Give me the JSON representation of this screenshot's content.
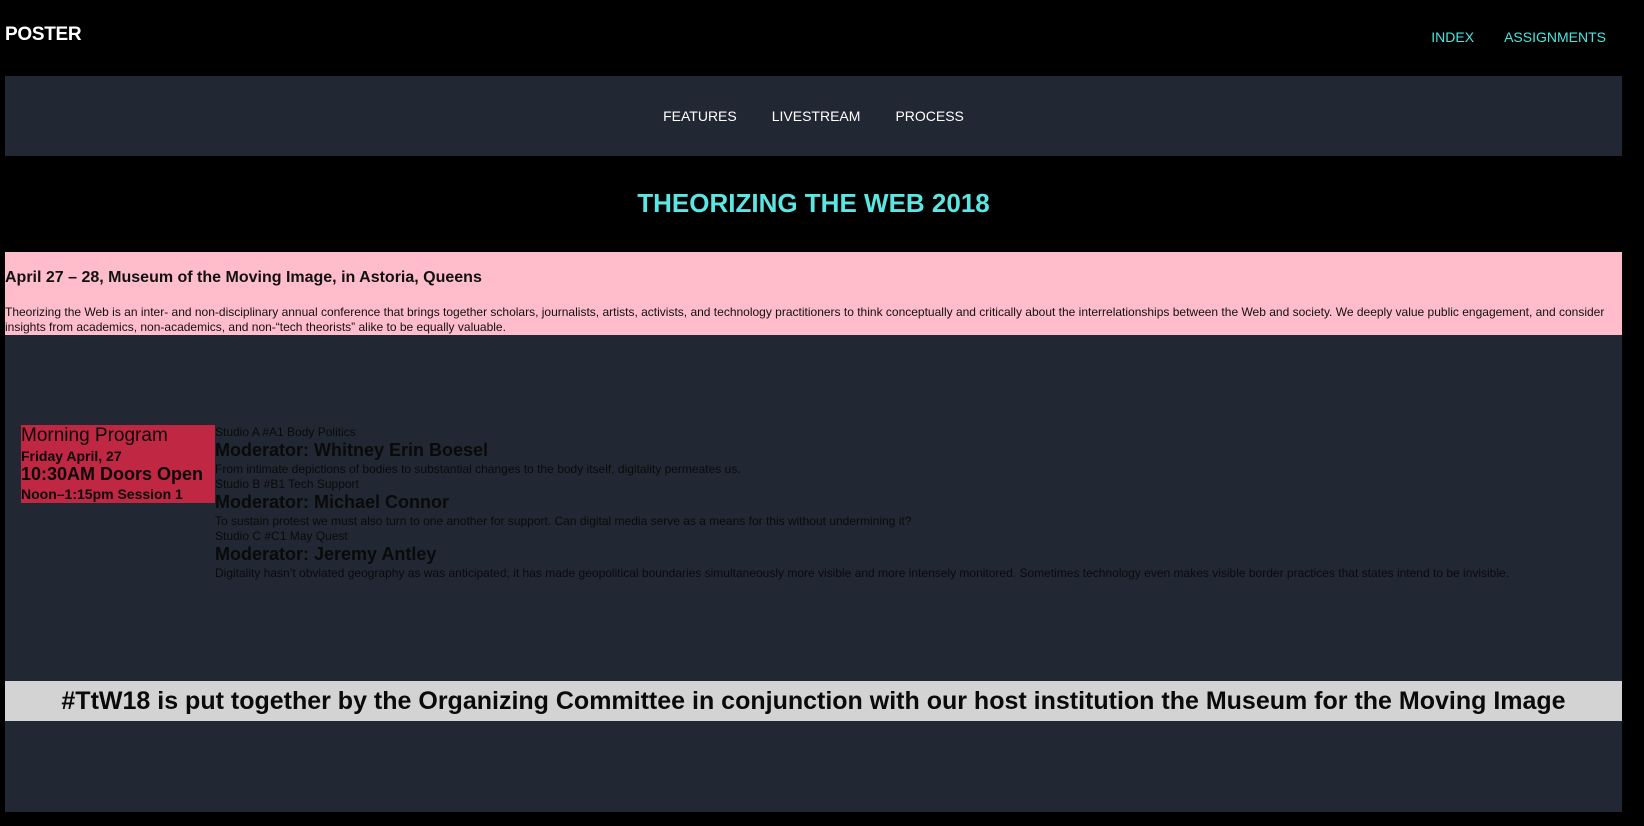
{
  "header": {
    "brand": "POSTER",
    "links": [
      "INDEX",
      "ASSIGNMENTS"
    ]
  },
  "subnav": {
    "items": [
      "FEATURES",
      "LIVESTREAM",
      "PROCESS"
    ]
  },
  "hero": {
    "title": "THEORIZING THE WEB 2018"
  },
  "intro": {
    "heading": "April 27 – 28, Museum of the Moving Image, in Astoria, Queens",
    "text": "Theorizing the Web is an inter- and non-disciplinary annual conference that brings together scholars, journalists, artists, activists, and technology practitioners to think conceptually and critically about the interrelationships between the Web and society. We deeply value public engagement, and consider insights from academics, non-academics, and non-“tech theorists” alike to be equally valuable."
  },
  "program": {
    "title": "Morning Program",
    "date": "Friday April, 27",
    "doors": "10:30AM Doors Open",
    "session": "Noon–1:15pm Session 1"
  },
  "sessions": [
    {
      "title": "Studio A #A1 Body Politics",
      "moderator": "Moderator: Whitney Erin Boesel",
      "description": "From intimate depictions of bodies to substantial changes to the body itself, digitality permeates us."
    },
    {
      "title": "Studio B #B1 Tech Support",
      "moderator": "Moderator: Michael Connor",
      "description": "To sustain protest we must also turn to one another for support. Can digital media serve as a means for this without undermining it?"
    },
    {
      "title": "Studio C #C1 May Quest",
      "moderator": "Moderator: Jeremy Antley",
      "description": "Digitality hasn’t obviated geography as was anticipated; it has made geopolitical boundaries simultaneously more visible and more intensely monitored. Sometimes technology even makes visible border practices that states intend to be invisible."
    }
  ],
  "footer": {
    "text": "#TtW18 is put together by the Organizing Committee in conjunction with our host institution the Museum for the Moving Image"
  },
  "colors": {
    "accent": "#49e6e1",
    "panel": "#212833",
    "pink": "#ffbccb",
    "program": "#c02743",
    "footer": "#d3d3d3"
  }
}
